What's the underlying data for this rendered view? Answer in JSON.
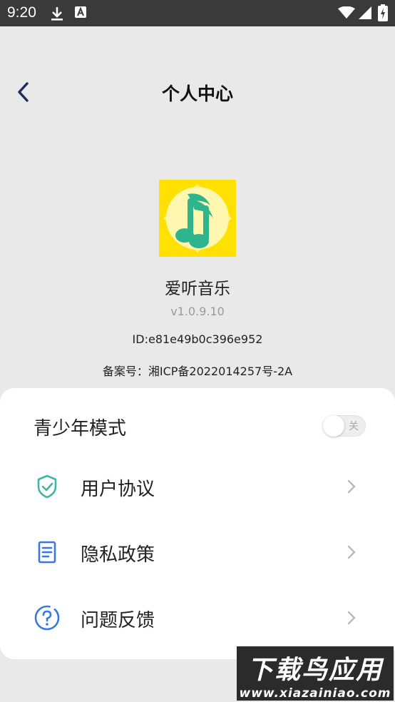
{
  "status_bar": {
    "time": "9:20"
  },
  "header": {
    "title": "个人中心"
  },
  "app": {
    "name": "爱听音乐",
    "version": "v1.0.9.10",
    "id": "ID:e81e49b0c396e952",
    "icp": "备案号：湘ICP备2022014257号-2A"
  },
  "menu": {
    "teen_mode": {
      "label": "青少年模式",
      "toggle_text": "关",
      "enabled": false
    },
    "items": [
      {
        "label": "用户协议",
        "icon": "shield-check-icon"
      },
      {
        "label": "隐私政策",
        "icon": "document-icon"
      },
      {
        "label": "问题反馈",
        "icon": "question-icon"
      }
    ]
  },
  "watermark": {
    "title": "下载鸟应用",
    "url": "www.xiazainiao.com"
  },
  "colors": {
    "accent": "#3a78e0",
    "teal": "#3fb6a0",
    "logo_bg": "#ffe000"
  }
}
